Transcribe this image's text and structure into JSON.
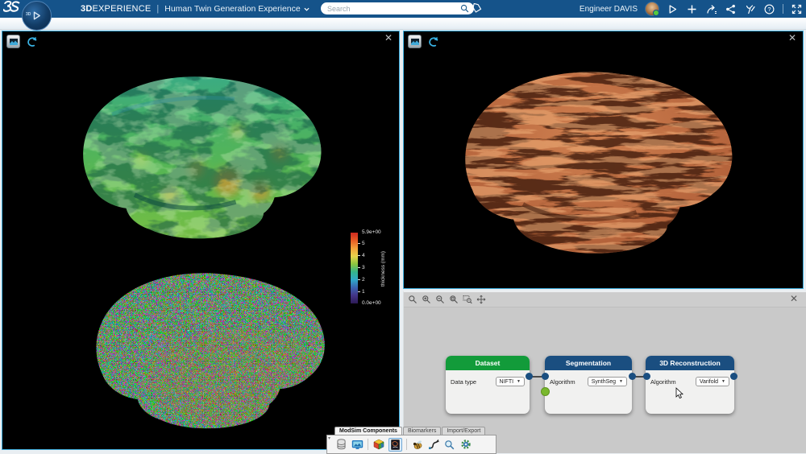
{
  "topbar": {
    "brand_bold": "3D",
    "brand_rest": "EXPERIENCE",
    "divider": "|",
    "app_title": "Human Twin Generation Experience",
    "compass_label": "3D",
    "search_placeholder": "Search",
    "user_name": "Engineer DAVIS",
    "icon_names": [
      "play-icon",
      "add-icon",
      "share-arrow-icon",
      "share-nodes-icon",
      "swym-icon",
      "help-icon",
      "fullscreen-icon"
    ]
  },
  "viewer_left": {
    "colorbar": {
      "max": "5.9e+00",
      "ticks": [
        "5",
        "4",
        "3",
        "2",
        "1"
      ],
      "min": "0.0e+00",
      "axis_label": "thickness (mm)"
    }
  },
  "pipeline": {
    "toolbar_icon_names": [
      "zoom",
      "zoom-in",
      "zoom-out",
      "zoom-fit",
      "zoom-selection",
      "pan"
    ],
    "nodes": [
      {
        "title": "Dataset",
        "header_color": "#129b3a",
        "param": "Data type",
        "value": "NIFTI"
      },
      {
        "title": "Segmentation",
        "header_color": "#1a4e80",
        "param": "Algorithm",
        "value": "SynthSeg"
      },
      {
        "title": "3D Reconstruction",
        "header_color": "#1a4e80",
        "param": "Algorithm",
        "value": "Varifold"
      }
    ]
  },
  "dock": {
    "tabs": [
      "ModSim Components",
      "Biomarkers",
      "Import/Export"
    ],
    "active_tab": "ModSim Components",
    "tool_icon_names": [
      "database",
      "display",
      "cube",
      "brain-panel",
      "bee",
      "spline",
      "magnifier",
      "gear"
    ]
  },
  "colors": {
    "topbar_blue": "#15538a",
    "accent_cyan": "#3fb0df",
    "node_green": "#129b3a",
    "node_blue": "#1a4e80",
    "panel_gray": "#c9c9c9",
    "copper": "#b5643c"
  }
}
